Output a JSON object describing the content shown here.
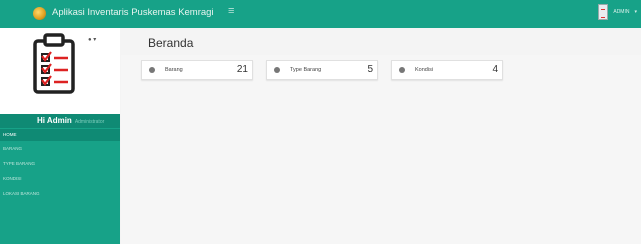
{
  "app": {
    "title": "Aplikasi Inventaris Puskemas Kemragi",
    "menu_toggle_icon": "hamburger-icon",
    "user_label": "ADMIN"
  },
  "sidebar": {
    "greeting": "Hi Admin",
    "greeting_sub": "Administrator",
    "items": [
      {
        "label": "HOME",
        "active": true
      },
      {
        "label": "BARANG",
        "active": false
      },
      {
        "label": "TYPE BARANG",
        "active": false
      },
      {
        "label": "KONDISI",
        "active": false
      },
      {
        "label": "LOKASI BARANG",
        "active": false
      }
    ]
  },
  "page": {
    "title": "Beranda"
  },
  "cards": [
    {
      "label": "Barang",
      "value": "21",
      "icon": "globe-icon"
    },
    {
      "label": "Type Barang",
      "value": "5",
      "icon": "globe-icon"
    },
    {
      "label": "Kondisi",
      "value": "4",
      "icon": "globe-icon"
    }
  ],
  "colors": {
    "primary": "#17a288",
    "primary_dark": "#0f8a74",
    "background": "#f4f4f4"
  }
}
